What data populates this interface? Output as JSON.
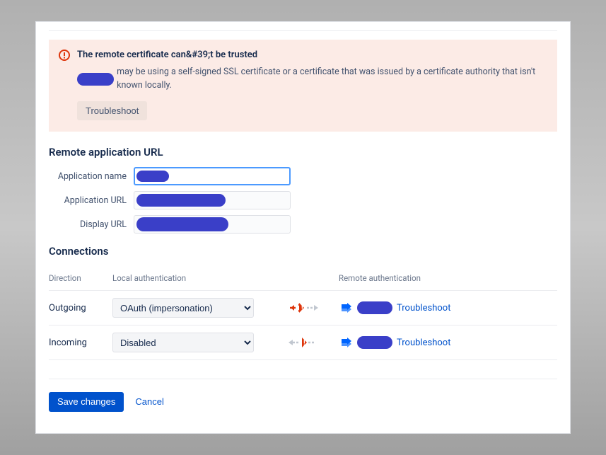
{
  "alert": {
    "title": "The remote certificate can&#39;t be trusted",
    "body_suffix": "may be using a self-signed SSL certificate or a certificate that was issued by a certificate authority that isn't known locally.",
    "troubleshoot": "Troubleshoot"
  },
  "form": {
    "section_title": "Remote application URL",
    "app_name_label": "Application name",
    "app_url_label": "Application URL",
    "display_url_label": "Display URL"
  },
  "connections": {
    "section_title": "Connections",
    "col_direction": "Direction",
    "col_local": "Local authentication",
    "col_remote": "Remote authentication",
    "rows": [
      {
        "direction": "Outgoing",
        "local": "OAuth (impersonation)",
        "troubleshoot": "Troubleshoot"
      },
      {
        "direction": "Incoming",
        "local": "Disabled",
        "troubleshoot": "Troubleshoot"
      }
    ]
  },
  "actions": {
    "save": "Save changes",
    "cancel": "Cancel"
  }
}
